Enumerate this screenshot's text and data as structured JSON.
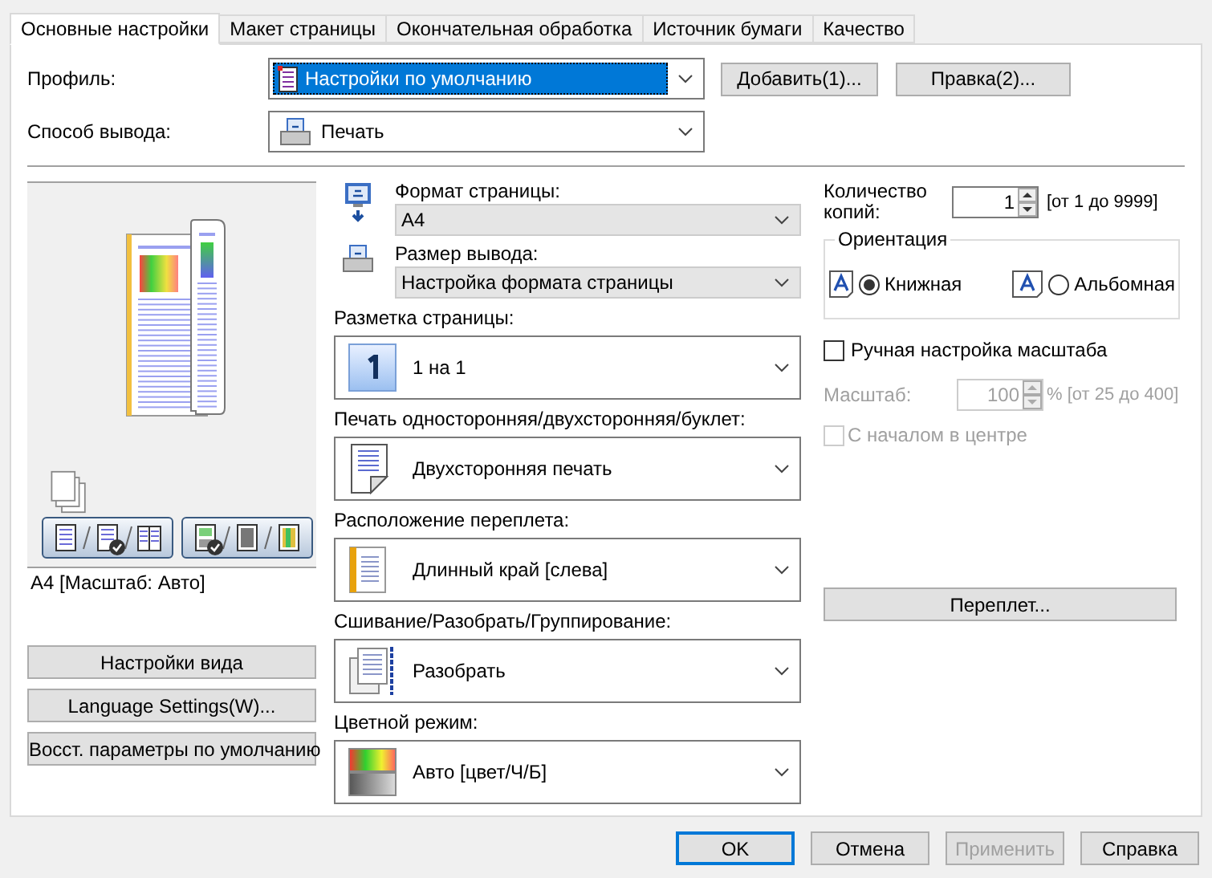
{
  "tabs": [
    {
      "label": "Основные настройки",
      "selected": true
    },
    {
      "label": "Макет страницы",
      "selected": false
    },
    {
      "label": "Окончательная обработка",
      "selected": false
    },
    {
      "label": "Источник бумаги",
      "selected": false
    },
    {
      "label": "Качество",
      "selected": false
    }
  ],
  "profile": {
    "label": "Профиль:",
    "value": "Настройки по умолчанию",
    "focused": true
  },
  "profile_buttons": [
    "Добавить(1)...",
    "Правка(2)..."
  ],
  "output_method": {
    "label": "Способ вывода:",
    "value": "Печать"
  },
  "preview": {
    "caption": "A4 [Масштаб: Авто]",
    "layout_modes": [
      {
        "kind": "single",
        "checked": false
      },
      {
        "kind": "duplex",
        "checked": true
      },
      {
        "kind": "booklet",
        "checked": false
      }
    ],
    "color_modes": [
      {
        "kind": "auto",
        "checked": true
      },
      {
        "kind": "mono",
        "checked": false
      },
      {
        "kind": "color",
        "checked": false
      }
    ]
  },
  "left_buttons": [
    "Настройки вида",
    "Language Settings(W)...",
    "Восст. параметры по умолчанию"
  ],
  "settings": [
    {
      "kind": "compact",
      "label": "Формат страницы:",
      "value": "A4"
    },
    {
      "kind": "compact",
      "label": "Размер вывода:",
      "value": "Настройка формата страницы"
    },
    {
      "kind": "large",
      "label": "Разметка страницы:",
      "value": "1 на 1"
    },
    {
      "kind": "large",
      "label": "Печать односторонняя/двухсторонняя/буклет:",
      "value": "Двухсторонняя печать"
    },
    {
      "kind": "large",
      "label": "Расположение переплета:",
      "value": "Длинный край [слева]"
    },
    {
      "kind": "large",
      "label": "Сшивание/Разобрать/Группирование:",
      "value": "Разобрать"
    },
    {
      "kind": "large",
      "label": "Цветной режим:",
      "value": "Авто [цвет/Ч/Б]"
    }
  ],
  "copies": {
    "label": "Количество копий:",
    "value": "1",
    "range": "[от 1 до 9999]"
  },
  "orientation": {
    "title": "Ориентация",
    "options": [
      {
        "label": "Книжная",
        "kind": "portrait",
        "selected": true
      },
      {
        "label": "Альбомная",
        "kind": "landscape",
        "selected": false
      }
    ]
  },
  "manual_scale": {
    "label": "Ручная настройка масштаба",
    "checked": false
  },
  "scale": {
    "label": "Масштаб:",
    "value": "100",
    "range": "% [от 25 до 400]",
    "disabled": true
  },
  "center": {
    "label": "С началом в центре",
    "checked": false,
    "disabled": true
  },
  "binding_button": "Переплет...",
  "footer_buttons": [
    {
      "label": "OK",
      "kind": "default",
      "disabled": false
    },
    {
      "label": "Отмена",
      "kind": "normal",
      "disabled": false
    },
    {
      "label": "Применить",
      "kind": "normal",
      "disabled": true
    },
    {
      "label": "Справка",
      "kind": "normal",
      "disabled": false
    }
  ]
}
